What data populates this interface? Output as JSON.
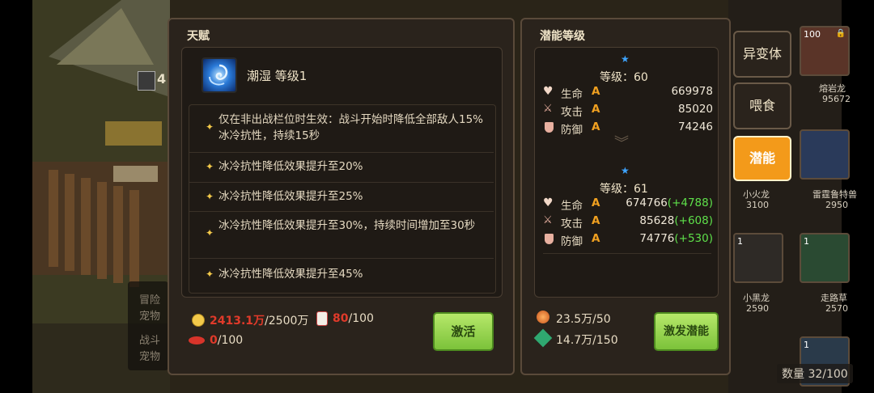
{
  "talent_panel": {
    "title": "天赋",
    "skill_name": "潮湿 等级1",
    "effects": [
      "仅在非出战栏位时生效：战斗开始时降低全部敌人15%冰冷抗性，持续15秒",
      "冰冷抗性降低效果提升至20%",
      "冰冷抗性降低效果提升至25%",
      "冰冷抗性降低效果提升至30%，持续时间增加至30秒",
      "冰冷抗性降低效果提升至45%"
    ],
    "gold_current": "2413.1万",
    "gold_required": "/2500万",
    "item_current": "80",
    "item_required": "/100",
    "gem_current": "0",
    "gem_required": "/100",
    "activate_label": "激活"
  },
  "potential_panel": {
    "title": "潜能等级",
    "current": {
      "level_text": "等级：60",
      "stats": [
        {
          "label": "生命",
          "grade": "A",
          "value": "669978",
          "gain": ""
        },
        {
          "label": "攻击",
          "grade": "A",
          "value": "85020",
          "gain": ""
        },
        {
          "label": "防御",
          "grade": "A",
          "value": "74246",
          "gain": ""
        }
      ]
    },
    "next": {
      "level_text": "等级：61",
      "stats": [
        {
          "label": "生命",
          "grade": "A",
          "value": "674766",
          "gain": "(+4788)"
        },
        {
          "label": "攻击",
          "grade": "A",
          "value": "85628",
          "gain": "(+608)"
        },
        {
          "label": "防御",
          "grade": "A",
          "value": "74776",
          "gain": "(+530)"
        }
      ]
    },
    "res1": "23.5万/50",
    "res2": "14.7万/150",
    "trigger_label": "激发潜能"
  },
  "tabs": {
    "mutate": "异变体",
    "feed": "喂食",
    "potential": "潜能"
  },
  "right_list": {
    "card1_level": "100",
    "card1_name": "熔岩龙",
    "card1_power": "95672",
    "card2_name": "小火龙",
    "card2_power": "3100",
    "card3_name": "雷霆鲁特兽",
    "card3_power": "2950",
    "card4_level": "1",
    "card5_level": "1",
    "card5_name": "小黑龙",
    "card5_power": "2590",
    "card6_name": "走路草",
    "card6_power": "2570",
    "card7_level": "1",
    "count": "数量 32/100"
  },
  "background": {
    "level_num": "4",
    "side_text1": "冒险",
    "side_text2": "宠物",
    "side_text3": "战斗",
    "side_text4": "宠物"
  },
  "colors": {
    "accent_orange": "#f39a1a",
    "gain_green": "#5ee04a",
    "red_short": "#e03a2a",
    "grade_orange": "#f0a020"
  }
}
